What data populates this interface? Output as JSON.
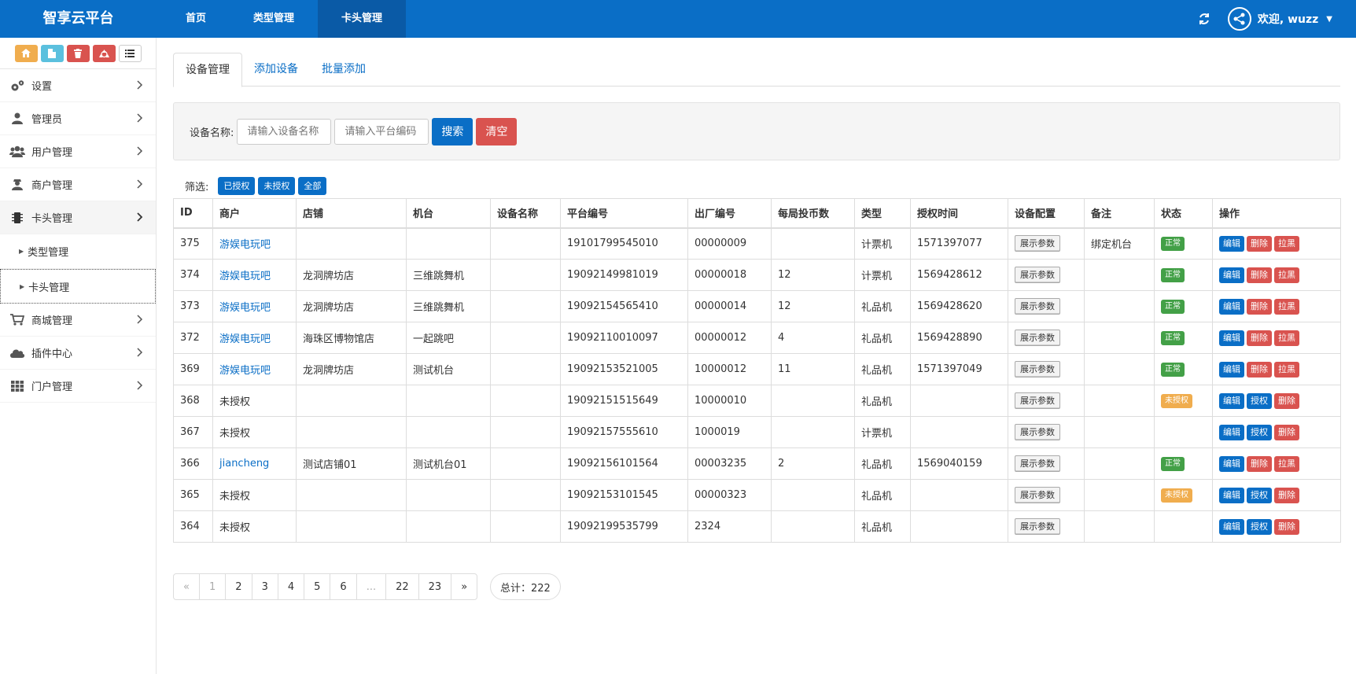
{
  "brand": "智享云平台",
  "topnav": [
    {
      "label": "首页",
      "active": false
    },
    {
      "label": "类型管理",
      "active": false
    },
    {
      "label": "卡头管理",
      "active": true
    }
  ],
  "user": {
    "greeting": "欢迎, wuzz"
  },
  "sidebar": {
    "shortcuts": [
      {
        "icon": "home-icon",
        "color": "#f0ad4e"
      },
      {
        "icon": "file-icon",
        "color": "#5bc0de"
      },
      {
        "icon": "trash-icon",
        "color": "#d9534f"
      },
      {
        "icon": "recycle-icon",
        "color": "#d9534f"
      },
      {
        "icon": "list-icon",
        "color": "#ffffff"
      }
    ],
    "menu": [
      {
        "label": "设置",
        "icon": "gears-icon"
      },
      {
        "label": "管理员",
        "icon": "user-icon"
      },
      {
        "label": "用户管理",
        "icon": "users-icon"
      },
      {
        "label": "商户管理",
        "icon": "merchant-icon"
      },
      {
        "label": "卡头管理",
        "icon": "chip-icon",
        "open": true
      },
      {
        "label": "商城管理",
        "icon": "cart-icon"
      },
      {
        "label": "插件中心",
        "icon": "cloud-icon"
      },
      {
        "label": "门户管理",
        "icon": "grid-icon"
      }
    ],
    "submenu": [
      {
        "label": "类型管理",
        "active": false
      },
      {
        "label": "卡头管理",
        "active": true
      }
    ]
  },
  "tabs": [
    {
      "label": "设备管理",
      "active": true
    },
    {
      "label": "添加设备",
      "active": false
    },
    {
      "label": "批量添加",
      "active": false
    }
  ],
  "search": {
    "label": "设备名称:",
    "name_placeholder": "请输入设备名称",
    "code_placeholder": "请输入平台编码",
    "search_label": "搜索",
    "clear_label": "清空"
  },
  "filter": {
    "label": "筛选:",
    "options": [
      "已授权",
      "未授权",
      "全部"
    ]
  },
  "table": {
    "headers": [
      "ID",
      "商户",
      "店铺",
      "机台",
      "设备名称",
      "平台编号",
      "出厂编号",
      "每局投币数",
      "类型",
      "授权时间",
      "设备配置",
      "备注",
      "状态",
      "操作"
    ],
    "param_label": "展示参数",
    "rows": [
      {
        "id": "375",
        "merchant": "游娱电玩吧",
        "link": true,
        "shop": "",
        "machine": "",
        "device": "",
        "platform": "19101799545010",
        "factory": "00000009",
        "coins": "",
        "type": "计票机",
        "auth_time": "1571397077",
        "remark": "绑定机台",
        "status": "正常",
        "status_kind": "ok",
        "actions": [
          "编辑",
          "删除",
          "拉黑"
        ]
      },
      {
        "id": "374",
        "merchant": "游娱电玩吧",
        "link": true,
        "shop": "龙洞牌坊店",
        "machine": "三维跳舞机",
        "device": "",
        "platform": "19092149981019",
        "factory": "00000018",
        "coins": "12",
        "type": "计票机",
        "auth_time": "1569428612",
        "remark": "",
        "status": "正常",
        "status_kind": "ok",
        "actions": [
          "编辑",
          "删除",
          "拉黑"
        ]
      },
      {
        "id": "373",
        "merchant": "游娱电玩吧",
        "link": true,
        "shop": "龙洞牌坊店",
        "machine": "三维跳舞机",
        "device": "",
        "platform": "19092154565410",
        "factory": "00000014",
        "coins": "12",
        "type": "礼品机",
        "auth_time": "1569428620",
        "remark": "",
        "status": "正常",
        "status_kind": "ok",
        "actions": [
          "编辑",
          "删除",
          "拉黑"
        ]
      },
      {
        "id": "372",
        "merchant": "游娱电玩吧",
        "link": true,
        "shop": "海珠区博物馆店",
        "machine": "一起跳吧",
        "device": "",
        "platform": "19092110010097",
        "factory": "00000012",
        "coins": "4",
        "type": "礼品机",
        "auth_time": "1569428890",
        "remark": "",
        "status": "正常",
        "status_kind": "ok",
        "actions": [
          "编辑",
          "删除",
          "拉黑"
        ]
      },
      {
        "id": "369",
        "merchant": "游娱电玩吧",
        "link": true,
        "shop": "龙洞牌坊店",
        "machine": "测试机台",
        "device": "",
        "platform": "19092153521005",
        "factory": "10000012",
        "coins": "11",
        "type": "礼品机",
        "auth_time": "1571397049",
        "remark": "",
        "status": "正常",
        "status_kind": "ok",
        "actions": [
          "编辑",
          "删除",
          "拉黑"
        ]
      },
      {
        "id": "368",
        "merchant": "未授权",
        "link": false,
        "shop": "",
        "machine": "",
        "device": "",
        "platform": "19092151515649",
        "factory": "10000010",
        "coins": "",
        "type": "礼品机",
        "auth_time": "",
        "remark": "",
        "status": "未授权",
        "status_kind": "warn",
        "actions": [
          "编辑",
          "授权",
          "删除"
        ]
      },
      {
        "id": "367",
        "merchant": "未授权",
        "link": false,
        "shop": "",
        "machine": "",
        "device": "",
        "platform": "19092157555610",
        "factory": "1000019",
        "coins": "",
        "type": "计票机",
        "auth_time": "",
        "remark": "",
        "status": "",
        "status_kind": "none",
        "actions": [
          "编辑",
          "授权",
          "删除"
        ]
      },
      {
        "id": "366",
        "merchant": "jiancheng",
        "link": true,
        "shop": "测试店铺01",
        "machine": "测试机台01",
        "device": "",
        "platform": "19092156101564",
        "factory": "00003235",
        "coins": "2",
        "type": "礼品机",
        "auth_time": "1569040159",
        "remark": "",
        "status": "正常",
        "status_kind": "ok",
        "actions": [
          "编辑",
          "删除",
          "拉黑"
        ]
      },
      {
        "id": "365",
        "merchant": "未授权",
        "link": false,
        "shop": "",
        "machine": "",
        "device": "",
        "platform": "19092153101545",
        "factory": "00000323",
        "coins": "",
        "type": "礼品机",
        "auth_time": "",
        "remark": "",
        "status": "未授权",
        "status_kind": "warn",
        "actions": [
          "编辑",
          "授权",
          "删除"
        ]
      },
      {
        "id": "364",
        "merchant": "未授权",
        "link": false,
        "shop": "",
        "machine": "",
        "device": "",
        "platform": "19092199535799",
        "factory": "2324",
        "coins": "",
        "type": "礼品机",
        "auth_time": "",
        "remark": "",
        "status": "",
        "status_kind": "none",
        "actions": [
          "编辑",
          "授权",
          "删除"
        ]
      }
    ]
  },
  "pagination": {
    "pages": [
      "«",
      "1",
      "2",
      "3",
      "4",
      "5",
      "6",
      "...",
      "22",
      "23",
      "»"
    ],
    "disabled": [
      "«",
      "1",
      "..."
    ],
    "total": "总计：222"
  },
  "colors": {
    "primary": "#0a6ec6",
    "danger": "#d9534f",
    "success": "#43a047",
    "warning": "#f0ad4e"
  }
}
